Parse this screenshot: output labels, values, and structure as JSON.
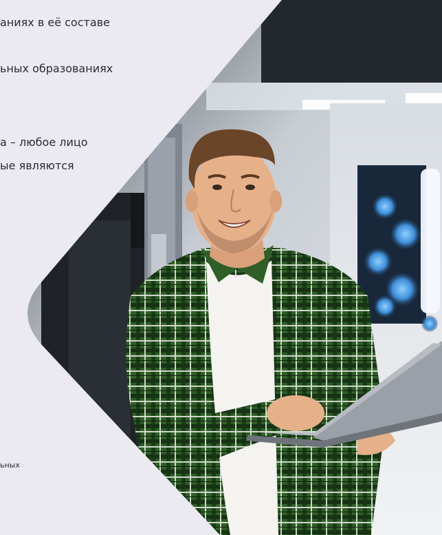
{
  "text": {
    "line1": "аниях в её составе",
    "line2": "ьных образованиях",
    "line3": "а – любое лицо",
    "line4": "ые являются",
    "footnote": "ьных"
  },
  "photo": {
    "shape": "rotated-rounded-square",
    "subject": "smiling man in green plaid shirt holding a laptop in a server room",
    "accent_colors": {
      "shirt": "#2d5a26",
      "tshirt": "#f3f2ee",
      "laptop": "#8b8f96",
      "lights": "#4fb3ff",
      "skin": "#e6b089"
    }
  }
}
